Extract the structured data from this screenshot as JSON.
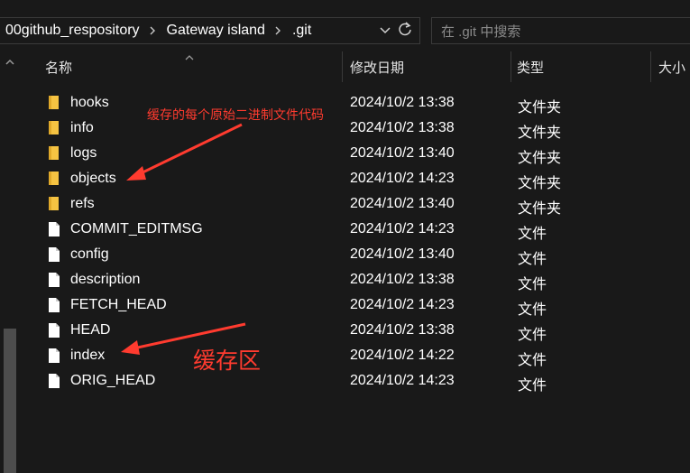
{
  "address_bar": {
    "breadcrumbs": [
      "00github_respository",
      "Gateway island",
      ".git"
    ],
    "dropdown_icon": "chevron-down-icon",
    "refresh_icon": "refresh-icon"
  },
  "search": {
    "placeholder": "在 .git 中搜索"
  },
  "columns": {
    "name": "名称",
    "modified": "修改日期",
    "type": "类型",
    "size": "大小"
  },
  "files": [
    {
      "name": "hooks",
      "modified": "2024/10/2 13:38",
      "type": "文件夹",
      "icon": "folder-icon"
    },
    {
      "name": "info",
      "modified": "2024/10/2 13:38",
      "type": "文件夹",
      "icon": "folder-icon"
    },
    {
      "name": "logs",
      "modified": "2024/10/2 13:40",
      "type": "文件夹",
      "icon": "folder-icon"
    },
    {
      "name": "objects",
      "modified": "2024/10/2 14:23",
      "type": "文件夹",
      "icon": "folder-icon"
    },
    {
      "name": "refs",
      "modified": "2024/10/2 13:40",
      "type": "文件夹",
      "icon": "folder-icon"
    },
    {
      "name": "COMMIT_EDITMSG",
      "modified": "2024/10/2 14:23",
      "type": "文件",
      "icon": "file-icon"
    },
    {
      "name": "config",
      "modified": "2024/10/2 13:40",
      "type": "文件",
      "icon": "file-icon"
    },
    {
      "name": "description",
      "modified": "2024/10/2 13:38",
      "type": "文件",
      "icon": "file-icon"
    },
    {
      "name": "FETCH_HEAD",
      "modified": "2024/10/2 14:23",
      "type": "文件",
      "icon": "file-icon"
    },
    {
      "name": "HEAD",
      "modified": "2024/10/2 13:38",
      "type": "文件",
      "icon": "file-icon"
    },
    {
      "name": "index",
      "modified": "2024/10/2 14:22",
      "type": "文件",
      "icon": "file-icon"
    },
    {
      "name": "ORIG_HEAD",
      "modified": "2024/10/2 14:23",
      "type": "文件",
      "icon": "file-icon"
    }
  ],
  "annotations": {
    "objects_note": "缓存的每个原始二进制文件代码",
    "index_note": "缓存区"
  },
  "colors": {
    "background": "#191919",
    "folder": "#f5c342",
    "annotation": "#ff3b2f",
    "border": "#3a3a3a"
  }
}
